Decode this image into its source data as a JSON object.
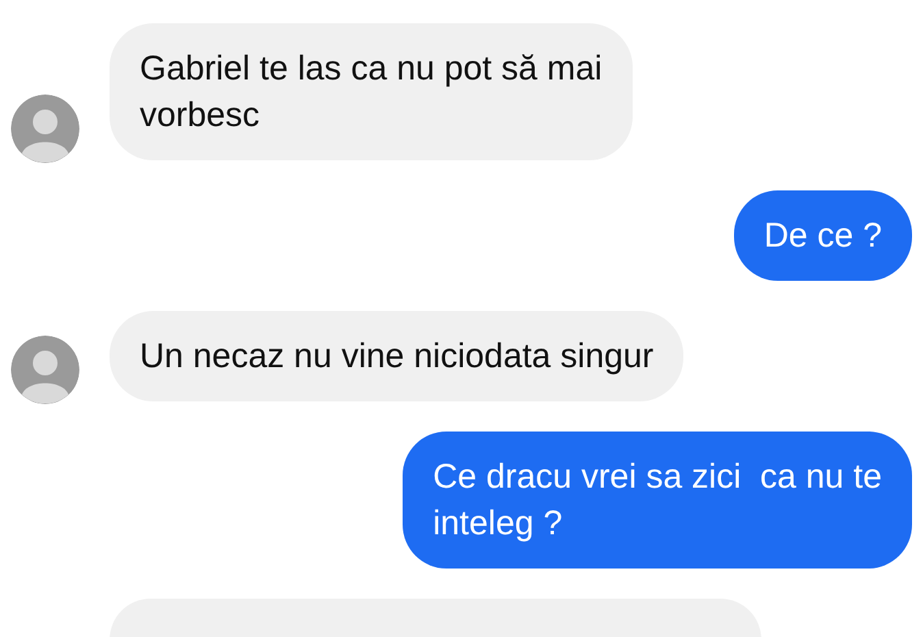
{
  "messages": [
    {
      "kind": "incoming",
      "avatar": true,
      "lines": [
        "Gabriel te las ca nu pot să mai",
        "vorbesc"
      ]
    },
    {
      "kind": "outgoing",
      "lines": [
        "De ce ?"
      ]
    },
    {
      "kind": "incoming",
      "avatar": true,
      "lines": [
        "Un necaz nu vine niciodata singur"
      ]
    },
    {
      "kind": "outgoing",
      "lines": [
        "Ce dracu vrei sa zici  ca nu te",
        "inteleg ?"
      ]
    },
    {
      "kind": "incoming",
      "avatar": false
    }
  ]
}
